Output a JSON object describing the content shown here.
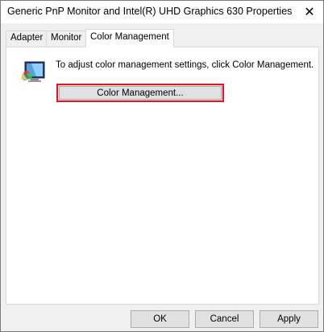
{
  "window": {
    "title": "Generic PnP Monitor and Intel(R) UHD Graphics 630 Properties",
    "close_glyph": "✕"
  },
  "tabs": [
    {
      "label": "Adapter",
      "active": false
    },
    {
      "label": "Monitor",
      "active": false
    },
    {
      "label": "Color Management",
      "active": true
    }
  ],
  "panel": {
    "description": "To adjust color management settings, click Color Management.",
    "color_management_button": "Color Management...",
    "icon": "color-monitor-icon"
  },
  "footer": {
    "ok_label": "OK",
    "cancel_label": "Cancel",
    "apply_label": "Apply"
  },
  "colors": {
    "highlight_border": "#e81123",
    "button_face": "#e1e1e1"
  }
}
